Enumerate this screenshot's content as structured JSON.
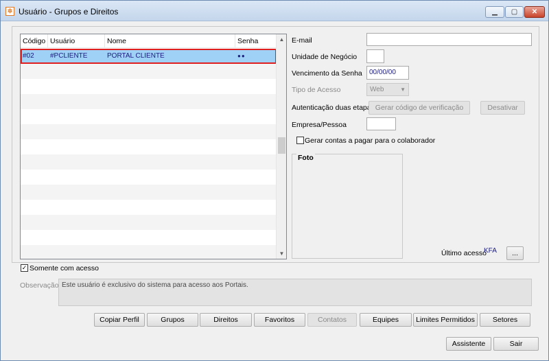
{
  "window": {
    "title": "Usuário - Grupos e Direitos",
    "app_icon_glyph": "✲",
    "controls": {
      "minimize": "▁",
      "maximize": "▢",
      "close": "✕"
    }
  },
  "grid": {
    "columns": [
      "Código",
      "Usuário",
      "Nome",
      "Senha"
    ],
    "rows": [
      {
        "codigo": "#02",
        "usuario": "#PCLIENTE",
        "nome": "PORTAL CLIENTE",
        "senha": "●●"
      }
    ],
    "scroll_up": "▲",
    "scroll_down": "▼"
  },
  "form": {
    "email_label": "E-mail",
    "email_value": "",
    "unidade_label": "Unidade de Negócio",
    "unidade_value": "",
    "vencimento_label": "Vencimento da Senha",
    "vencimento_value": "00/00/00",
    "tipo_acesso_label": "Tipo de Acesso",
    "tipo_acesso_value": "Web",
    "autenticacao_label": "Autenticação duas etapas",
    "gerar_codigo_button": "Gerar código de verificação",
    "desativar_button": "Desativar",
    "empresa_label": "Empresa/Pessoa",
    "empresa_value": "",
    "gerar_contas_label": "Gerar contas a pagar para o colaborador",
    "gerar_contas_checked": false,
    "foto_label": "Foto",
    "ultimo_acesso_label": "Último acesso",
    "ultimo_acesso_value": "KFA",
    "ultimo_acesso_button": "...",
    "somente_acesso_label": "Somente com acesso",
    "somente_acesso_checked": true,
    "somente_acesso_mark": "✓"
  },
  "observacao": {
    "label": "Observação",
    "text": "Este usuário é exclusivo do sistema para acesso aos Portais."
  },
  "toolbar": {
    "copiar_perfil": "Copiar Perfil",
    "grupos": "Grupos",
    "direitos": "Direitos",
    "favoritos": "Favoritos",
    "contatos": "Contatos",
    "equipes": "Equipes",
    "limites": "Limites Permitidos",
    "setores": "Setores"
  },
  "footer": {
    "assistente": "Assistente",
    "sair": "Sair"
  },
  "colors": {
    "selection": "#9fd0f5",
    "highlight_border": "#e01e1e",
    "value_text": "#1b1b80"
  }
}
